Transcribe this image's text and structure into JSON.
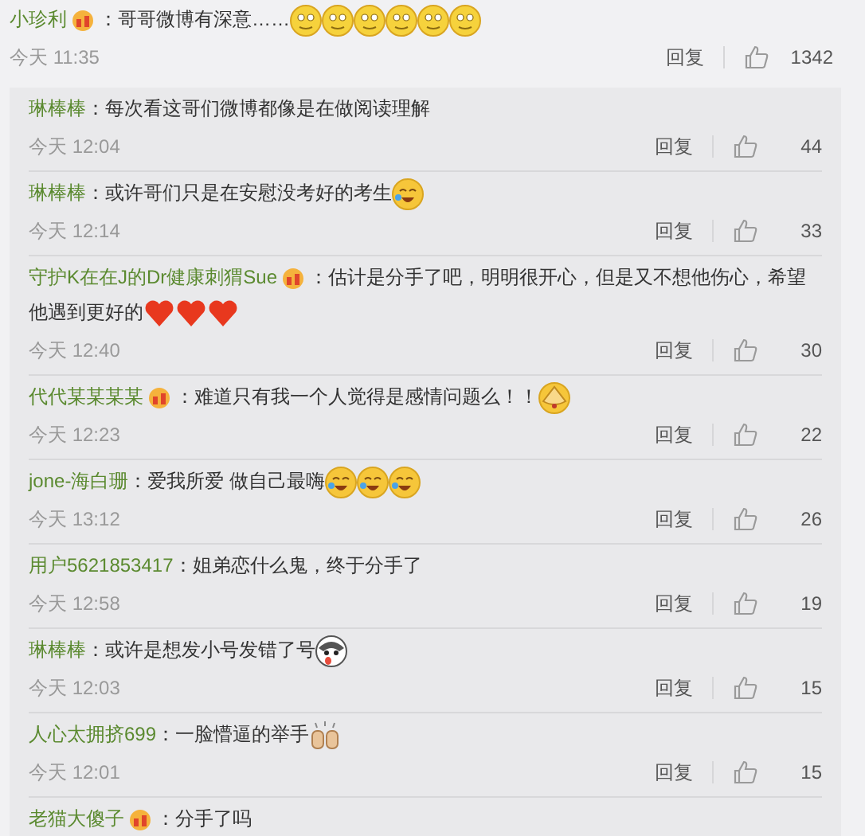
{
  "comment": {
    "name": "小珍利",
    "badge": true,
    "text": "：哥哥微博有深意……",
    "emojis": [
      {
        "kind": "smile"
      },
      {
        "kind": "smile"
      },
      {
        "kind": "smile"
      },
      {
        "kind": "smile"
      },
      {
        "kind": "smile"
      },
      {
        "kind": "smile"
      }
    ],
    "time": "今天 11:35",
    "reply": "回复",
    "likes": "1342"
  },
  "replies": [
    {
      "name": "琳棒棒",
      "badge": false,
      "text": "：每次看这哥们微博都像是在做阅读理解",
      "time": "今天 12:04",
      "reply": "回复",
      "likes": "44"
    },
    {
      "name": "琳棒棒",
      "badge": false,
      "text": "：或许哥们只是在安慰没考好的考生",
      "emojis": [
        {
          "kind": "laugh-cry"
        }
      ],
      "time": "今天 12:14",
      "reply": "回复",
      "likes": "33"
    },
    {
      "name": "守护K在在J的Dr健康刺猬Sue",
      "badge": true,
      "text": "：估计是分手了吧，明明很开心，但是又不想他伤心，希望他遇到更好的",
      "emojis": [
        {
          "kind": "heart"
        },
        {
          "kind": "heart"
        },
        {
          "kind": "heart"
        }
      ],
      "time": "今天 12:40",
      "reply": "回复",
      "likes": "30"
    },
    {
      "name": "代代某某某某",
      "badge": true,
      "text": "：难道只有我一个人觉得是感情问题么！！",
      "emojis": [
        {
          "kind": "cover-face"
        }
      ],
      "time": "今天 12:23",
      "reply": "回复",
      "likes": "22"
    },
    {
      "name": "jone-海白珊",
      "badge": false,
      "text": "：爱我所爱 做自己最嗨",
      "emojis": [
        {
          "kind": "laugh-cry"
        },
        {
          "kind": "laugh-cry"
        },
        {
          "kind": "laugh-cry"
        }
      ],
      "time": "今天 13:12",
      "reply": "回复",
      "likes": "26"
    },
    {
      "name": "用户5621853417",
      "badge": false,
      "text": "：姐弟恋什么鬼，终于分手了",
      "time": "今天 12:58",
      "reply": "回复",
      "likes": "19"
    },
    {
      "name": "琳棒棒",
      "badge": false,
      "text": "：或许是想发小号发错了号",
      "emojis": [
        {
          "kind": "dog"
        }
      ],
      "time": "今天 12:03",
      "reply": "回复",
      "likes": "15"
    },
    {
      "name": "人心太拥挤699",
      "badge": false,
      "text": "：一脸懵逼的举手",
      "emojis": [
        {
          "kind": "hands"
        }
      ],
      "time": "今天 12:01",
      "reply": "回复",
      "likes": "15"
    },
    {
      "name": "老猫大傻子",
      "badge": true,
      "text": "：分手了吗"
    }
  ]
}
